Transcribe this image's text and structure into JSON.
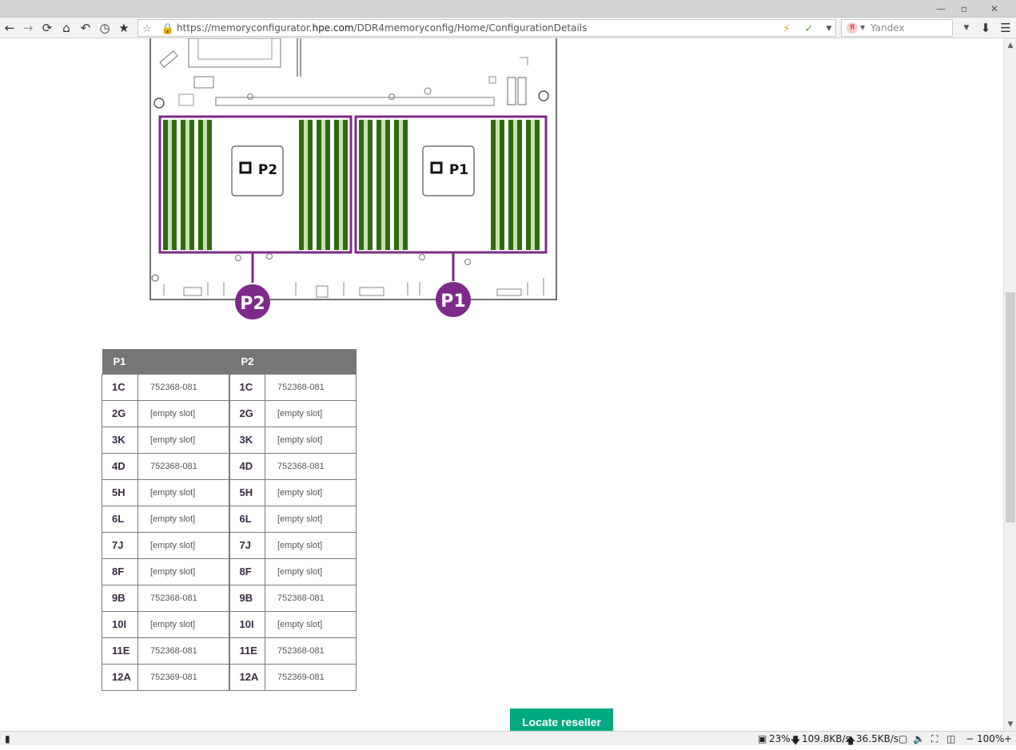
{
  "browser": {
    "url_prefix": "https://memoryconfigurator.",
    "url_host": "hpe.com",
    "url_path": "/DDR4memoryconfig/Home/ConfigurationDetails",
    "search_placeholder": "Yandex",
    "window_buttons": {
      "minimize": "—",
      "restore": "▫",
      "close": "✕"
    },
    "nav_icons": [
      "back-icon",
      "forward-icon",
      "reload-icon",
      "home-icon",
      "undo-icon",
      "history-icon",
      "bookmarks-icon"
    ]
  },
  "diagram": {
    "cpu_left": "P2",
    "cpu_right": "P1",
    "badge_left": "P2",
    "badge_right": "P1",
    "accent_color": "#7d2a8a",
    "dimm_color": "#2f6b0e"
  },
  "table": {
    "headers": [
      "P1",
      "P2"
    ],
    "p1": [
      {
        "slot": "1C",
        "part": "752368-081"
      },
      {
        "slot": "2G",
        "part": "[empty slot]"
      },
      {
        "slot": "3K",
        "part": "[empty slot]"
      },
      {
        "slot": "4D",
        "part": "752368-081"
      },
      {
        "slot": "5H",
        "part": "[empty slot]"
      },
      {
        "slot": "6L",
        "part": "[empty slot]"
      },
      {
        "slot": "7J",
        "part": "[empty slot]"
      },
      {
        "slot": "8F",
        "part": "[empty slot]"
      },
      {
        "slot": "9B",
        "part": "752368-081"
      },
      {
        "slot": "10I",
        "part": "[empty slot]"
      },
      {
        "slot": "11E",
        "part": "752368-081"
      },
      {
        "slot": "12A",
        "part": "752369-081"
      }
    ],
    "p2": [
      {
        "slot": "1C",
        "part": "752368-081"
      },
      {
        "slot": "2G",
        "part": "[empty slot]"
      },
      {
        "slot": "3K",
        "part": "[empty slot]"
      },
      {
        "slot": "4D",
        "part": "752368-081"
      },
      {
        "slot": "5H",
        "part": "[empty slot]"
      },
      {
        "slot": "6L",
        "part": "[empty slot]"
      },
      {
        "slot": "7J",
        "part": "[empty slot]"
      },
      {
        "slot": "8F",
        "part": "[empty slot]"
      },
      {
        "slot": "9B",
        "part": "752368-081"
      },
      {
        "slot": "10I",
        "part": "[empty slot]"
      },
      {
        "slot": "11E",
        "part": "752368-081"
      },
      {
        "slot": "12A",
        "part": "752369-081"
      }
    ]
  },
  "locate_button": "Locate reseller",
  "status": {
    "cpu": "23%",
    "download": "109.8KB/s",
    "upload": "36.5KB/s",
    "zoom": "100%",
    "zoom_minus": "−",
    "zoom_plus": "+"
  }
}
